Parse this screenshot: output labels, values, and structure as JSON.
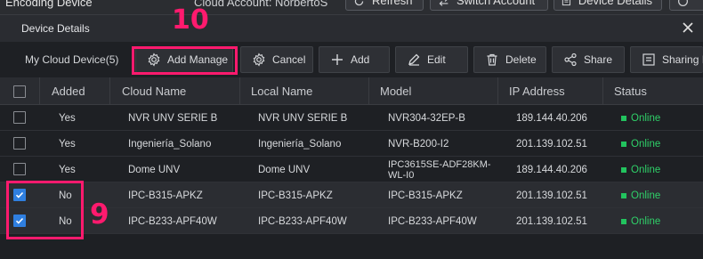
{
  "parent": {
    "title": "Encoding Device",
    "cloud_account": "Cloud Account: NorbertoS",
    "buttons": {
      "refresh": "Refresh",
      "switch_account": "Switch Account",
      "device_details": "Device Details"
    }
  },
  "dialog": {
    "title": "Device Details"
  },
  "toolbar": {
    "cloud_device_label": "My Cloud Device(5)",
    "add_manage": "Add Manage",
    "cancel": "Cancel",
    "add": "Add",
    "edit": "Edit",
    "delete": "Delete",
    "share": "Share",
    "sharing": "Sharing I"
  },
  "table": {
    "columns": [
      "Added",
      "Cloud Name",
      "Local Name",
      "Model",
      "IP Address",
      "Status"
    ],
    "rows": [
      {
        "checked": false,
        "added": "Yes",
        "cloud_name": "NVR UNV SERIE B",
        "local_name": "NVR UNV SERIE B",
        "model": "NVR304-32EP-B",
        "ip": "189.144.40.206",
        "status": "Online"
      },
      {
        "checked": false,
        "added": "Yes",
        "cloud_name": "Ingeniería_Solano",
        "local_name": "Ingeniería_Solano",
        "model": "NVR-B200-I2",
        "ip": "201.139.102.51",
        "status": "Online"
      },
      {
        "checked": false,
        "added": "Yes",
        "cloud_name": "Dome UNV",
        "local_name": "Dome UNV",
        "model": "IPC3615SE-ADF28KM-WL-I0",
        "ip": "189.144.40.206",
        "status": "Online"
      },
      {
        "checked": true,
        "added": "No",
        "cloud_name": "IPC-B315-APKZ",
        "local_name": "IPC-B315-APKZ",
        "model": "IPC-B315-APKZ",
        "ip": "201.139.102.51",
        "status": "Online"
      },
      {
        "checked": true,
        "added": "No",
        "cloud_name": "IPC-B233-APF40W",
        "local_name": "IPC-B233-APF40W",
        "model": "IPC-B233-APF40W",
        "ip": "201.139.102.51",
        "status": "Online"
      }
    ]
  },
  "annotations": {
    "step_add_manage": "10",
    "step_select_rows": "9"
  },
  "colors": {
    "accent": "#2f7fe0",
    "online": "#22c35e",
    "annotation": "#ff1a6e"
  },
  "icons": [
    "gear-icon",
    "cancel-gear-icon",
    "plus-icon",
    "pencil-icon",
    "trash-icon",
    "share-icon",
    "close-icon",
    "refresh-icon",
    "switch-icon",
    "details-icon"
  ]
}
